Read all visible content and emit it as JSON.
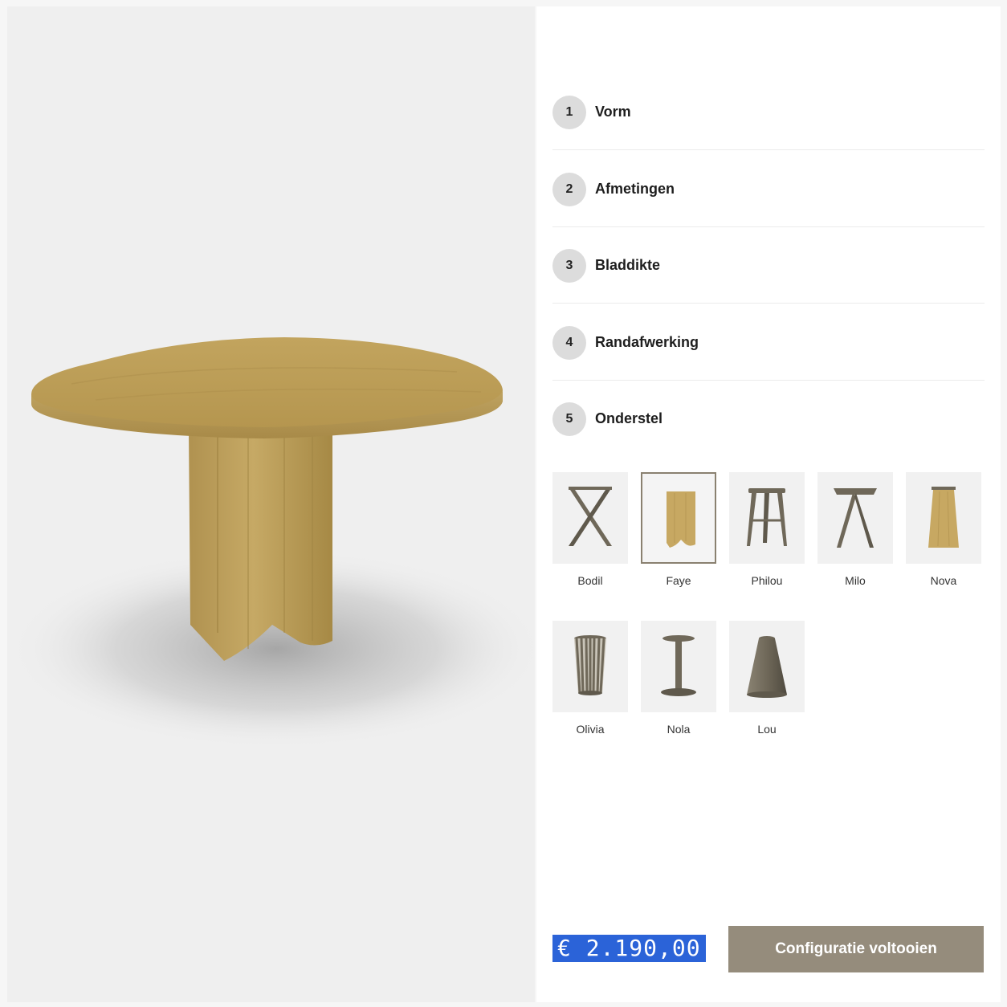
{
  "steps": [
    {
      "number": "1",
      "label": "Vorm"
    },
    {
      "number": "2",
      "label": "Afmetingen"
    },
    {
      "number": "3",
      "label": "Bladdikte"
    },
    {
      "number": "4",
      "label": "Randafwerking"
    },
    {
      "number": "5",
      "label": "Onderstel"
    }
  ],
  "bases": [
    {
      "name": "Bodil",
      "selected": false,
      "material": "metal"
    },
    {
      "name": "Faye",
      "selected": true,
      "material": "oak"
    },
    {
      "name": "Philou",
      "selected": false,
      "material": "metal"
    },
    {
      "name": "Milo",
      "selected": false,
      "material": "metal"
    },
    {
      "name": "Nova",
      "selected": false,
      "material": "oak"
    },
    {
      "name": "Olivia",
      "selected": false,
      "material": "metal"
    },
    {
      "name": "Nola",
      "selected": false,
      "material": "metal"
    },
    {
      "name": "Lou",
      "selected": false,
      "material": "metal"
    }
  ],
  "footer": {
    "price": "€ 2.190,00",
    "cta_label": "Configuratie voltooien"
  },
  "colors": {
    "oak": "#c7a862",
    "metal": "#6f6859",
    "cta": "#958c7c",
    "price_highlight": "#2b63d8"
  }
}
